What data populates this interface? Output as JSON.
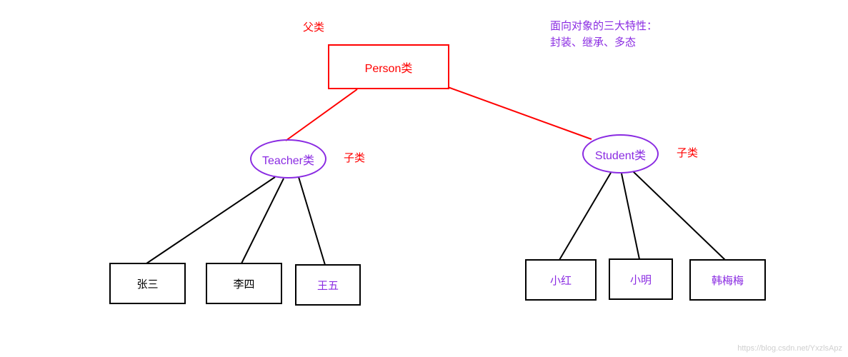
{
  "annotations": {
    "parent": "父类",
    "child": "子类",
    "features_title": "面向对象的三大特性：",
    "features_list": "封装、继承、多态"
  },
  "parent_node": {
    "label": "Person类"
  },
  "children": {
    "teacher": {
      "label": "Teacher类",
      "instances": [
        {
          "label": "张三",
          "color": "black"
        },
        {
          "label": "李四",
          "color": "black"
        },
        {
          "label": "王五",
          "color": "purple"
        }
      ]
    },
    "student": {
      "label": "Student类",
      "instances": [
        {
          "label": "小红",
          "color": "purple"
        },
        {
          "label": "小明",
          "color": "purple"
        },
        {
          "label": "韩梅梅",
          "color": "purple"
        }
      ]
    }
  },
  "watermark": "https://blog.csdn.net/YxzlsApz"
}
